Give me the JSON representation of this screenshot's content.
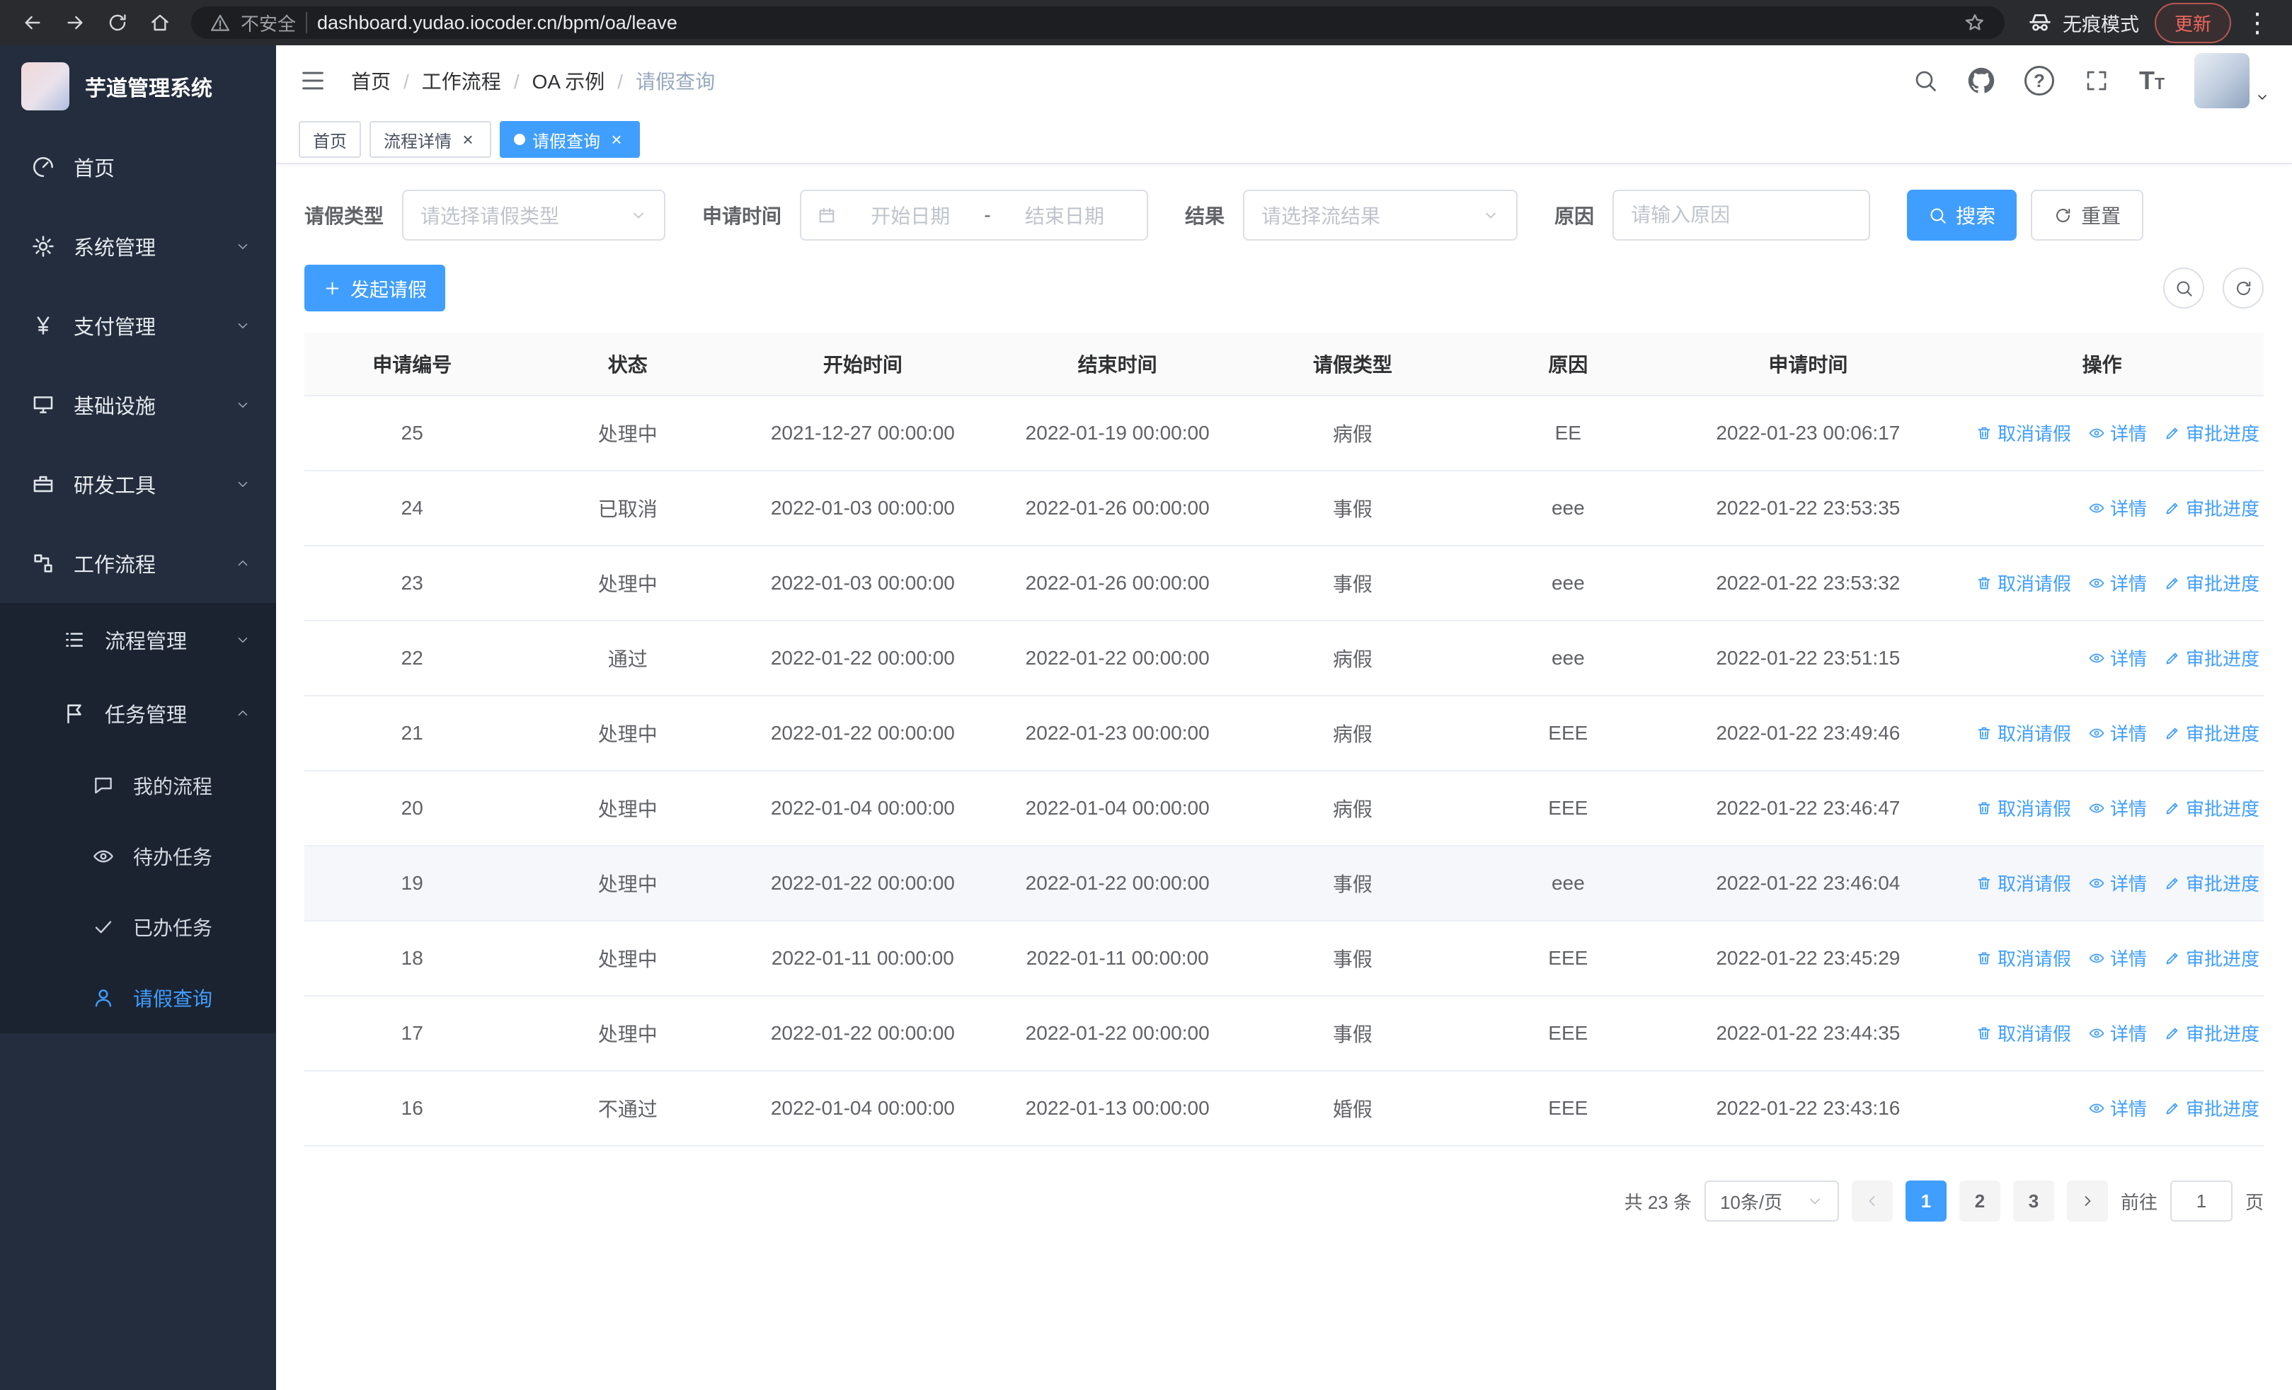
{
  "colors": {
    "primary": "#409eff",
    "sidebar_bg": "#232d3d",
    "submenu_bg": "#1b2330",
    "update_red": "#ee675c"
  },
  "browser": {
    "security_chip": "不安全",
    "url": "dashboard.yudao.iocoder.cn/bpm/oa/leave",
    "incognito_label": "无痕模式",
    "update_label": "更新"
  },
  "sidebar": {
    "logo_title": "芋道管理系统",
    "menu": [
      {
        "label": "首页",
        "icon": "dashboard"
      },
      {
        "label": "系统管理",
        "icon": "gear",
        "chevron": "down"
      },
      {
        "label": "支付管理",
        "icon": "yen",
        "chevron": "down"
      },
      {
        "label": "基础设施",
        "icon": "monitor",
        "chevron": "down"
      },
      {
        "label": "研发工具",
        "icon": "toolbox",
        "chevron": "down"
      },
      {
        "label": "工作流程",
        "icon": "workflow",
        "chevron": "up",
        "active": true
      }
    ],
    "submenu": [
      {
        "label": "流程管理",
        "icon": "list",
        "chevron": "down"
      },
      {
        "label": "任务管理",
        "icon": "flag",
        "chevron": "up",
        "expanded": true
      }
    ],
    "leafmenu": [
      {
        "label": "我的流程",
        "icon": "chat"
      },
      {
        "label": "待办任务",
        "icon": "eye"
      },
      {
        "label": "已办任务",
        "icon": "check"
      },
      {
        "label": "请假查询",
        "icon": "user",
        "active": true
      }
    ]
  },
  "header": {
    "breadcrumb": [
      {
        "label": "首页"
      },
      {
        "label": "工作流程"
      },
      {
        "label": "OA 示例"
      },
      {
        "label": "请假查询"
      }
    ]
  },
  "tabs": [
    {
      "label": "首页",
      "closable": false
    },
    {
      "label": "流程详情",
      "closable": true
    },
    {
      "label": "请假查询",
      "closable": true,
      "active": true
    }
  ],
  "filters": {
    "leave_type_label": "请假类型",
    "leave_type_placeholder": "请选择请假类型",
    "apply_time_label": "申请时间",
    "start_placeholder": "开始日期",
    "range_separator": "-",
    "end_placeholder": "结束日期",
    "result_label": "结果",
    "result_placeholder": "请选择流结果",
    "reason_label": "原因",
    "reason_placeholder": "请输入原因",
    "search_label": "搜索",
    "reset_label": "重置"
  },
  "toolbar": {
    "create_label": "发起请假"
  },
  "table": {
    "columns": [
      "申请编号",
      "状态",
      "开始时间",
      "结束时间",
      "请假类型",
      "原因",
      "申请时间",
      "操作"
    ],
    "actions_map": {
      "cancel": {
        "label": "取消请假",
        "icon": "trash"
      },
      "detail": {
        "label": "详情",
        "icon": "eye"
      },
      "progress": {
        "label": "审批进度",
        "icon": "pen"
      }
    },
    "rows": [
      {
        "id": "25",
        "status": "处理中",
        "start": "2021-12-27 00:00:00",
        "end": "2022-01-19 00:00:00",
        "type": "病假",
        "reason": "EE",
        "apply_time": "2022-01-23 00:06:17",
        "actions": [
          "cancel",
          "detail",
          "progress"
        ]
      },
      {
        "id": "24",
        "status": "已取消",
        "start": "2022-01-03 00:00:00",
        "end": "2022-01-26 00:00:00",
        "type": "事假",
        "reason": "eee",
        "apply_time": "2022-01-22 23:53:35",
        "actions": [
          "detail",
          "progress"
        ]
      },
      {
        "id": "23",
        "status": "处理中",
        "start": "2022-01-03 00:00:00",
        "end": "2022-01-26 00:00:00",
        "type": "事假",
        "reason": "eee",
        "apply_time": "2022-01-22 23:53:32",
        "actions": [
          "cancel",
          "detail",
          "progress"
        ]
      },
      {
        "id": "22",
        "status": "通过",
        "start": "2022-01-22 00:00:00",
        "end": "2022-01-22 00:00:00",
        "type": "病假",
        "reason": "eee",
        "apply_time": "2022-01-22 23:51:15",
        "actions": [
          "detail",
          "progress"
        ]
      },
      {
        "id": "21",
        "status": "处理中",
        "start": "2022-01-22 00:00:00",
        "end": "2022-01-23 00:00:00",
        "type": "病假",
        "reason": "EEE",
        "apply_time": "2022-01-22 23:49:46",
        "actions": [
          "cancel",
          "detail",
          "progress"
        ]
      },
      {
        "id": "20",
        "status": "处理中",
        "start": "2022-01-04 00:00:00",
        "end": "2022-01-04 00:00:00",
        "type": "病假",
        "reason": "EEE",
        "apply_time": "2022-01-22 23:46:47",
        "actions": [
          "cancel",
          "detail",
          "progress"
        ]
      },
      {
        "id": "19",
        "status": "处理中",
        "start": "2022-01-22 00:00:00",
        "end": "2022-01-22 00:00:00",
        "type": "事假",
        "reason": "eee",
        "apply_time": "2022-01-22 23:46:04",
        "actions": [
          "cancel",
          "detail",
          "progress"
        ],
        "hover": true
      },
      {
        "id": "18",
        "status": "处理中",
        "start": "2022-01-11 00:00:00",
        "end": "2022-01-11 00:00:00",
        "type": "事假",
        "reason": "EEE",
        "apply_time": "2022-01-22 23:45:29",
        "actions": [
          "cancel",
          "detail",
          "progress"
        ]
      },
      {
        "id": "17",
        "status": "处理中",
        "start": "2022-01-22 00:00:00",
        "end": "2022-01-22 00:00:00",
        "type": "事假",
        "reason": "EEE",
        "apply_time": "2022-01-22 23:44:35",
        "actions": [
          "cancel",
          "detail",
          "progress"
        ]
      },
      {
        "id": "16",
        "status": "不通过",
        "start": "2022-01-04 00:00:00",
        "end": "2022-01-13 00:00:00",
        "type": "婚假",
        "reason": "EEE",
        "apply_time": "2022-01-22 23:43:16",
        "actions": [
          "detail",
          "progress"
        ]
      }
    ]
  },
  "pagination": {
    "total": "共 23 条",
    "page_size": "10条/页",
    "pages": [
      {
        "label": "1",
        "active": true
      },
      {
        "label": "2"
      },
      {
        "label": "3"
      }
    ],
    "goto_prefix": "前往",
    "goto_value": "1",
    "goto_suffix": "页"
  }
}
